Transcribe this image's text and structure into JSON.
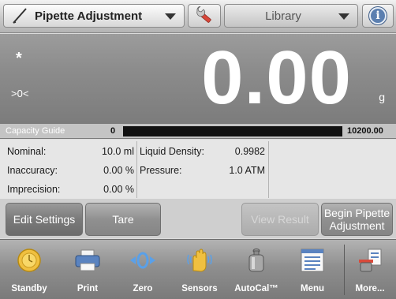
{
  "header": {
    "app_name": "Pipette Adjustment",
    "library_label": "Library",
    "info_glyph": "i",
    "icons": [
      "pencil-icon",
      "wrench-icon",
      "chevron-down-icon",
      "info-icon"
    ]
  },
  "display": {
    "stable_indicator": "*",
    "center_zero_indicator": ">0<",
    "weight": "0.00",
    "unit": "g"
  },
  "capacity_guide": {
    "label": "Capacity Guide",
    "min": "0",
    "max": "10200.00",
    "fill_fraction": 0.0
  },
  "info_panel": {
    "nominal_label": "Nominal:",
    "nominal_value": "10.0 ml",
    "inaccuracy_label": "Inaccuracy:",
    "inaccuracy_value": "0.00 %",
    "imprecision_label": "Imprecision:",
    "imprecision_value": "0.00 %",
    "liquid_density_label": "Liquid Density:",
    "liquid_density_value": "0.9982",
    "pressure_label": "Pressure:",
    "pressure_value": "1.0 ATM"
  },
  "actions": {
    "edit_settings": "Edit Settings",
    "tare": "Tare",
    "view_result": "View Result",
    "begin_line1": "Begin Pipette",
    "begin_line2": "Adjustment"
  },
  "toolbar": {
    "items": [
      {
        "label": "Standby",
        "icon": "standby-icon"
      },
      {
        "label": "Print",
        "icon": "printer-icon"
      },
      {
        "label": "Zero",
        "icon": "zero-icon"
      },
      {
        "label": "Sensors",
        "icon": "hand-sensor-icon"
      },
      {
        "label": "AutoCal™",
        "icon": "calibration-weight-icon"
      },
      {
        "label": "Menu",
        "icon": "menu-icon"
      },
      {
        "label": "More...",
        "icon": "more-icon"
      }
    ]
  },
  "colors": {
    "display_bg": "#8c8c8c",
    "capacity_fill": "#4a9c3a",
    "info_blue": "#5b7fb0",
    "toolbar_bg": "#8f8f8f"
  }
}
